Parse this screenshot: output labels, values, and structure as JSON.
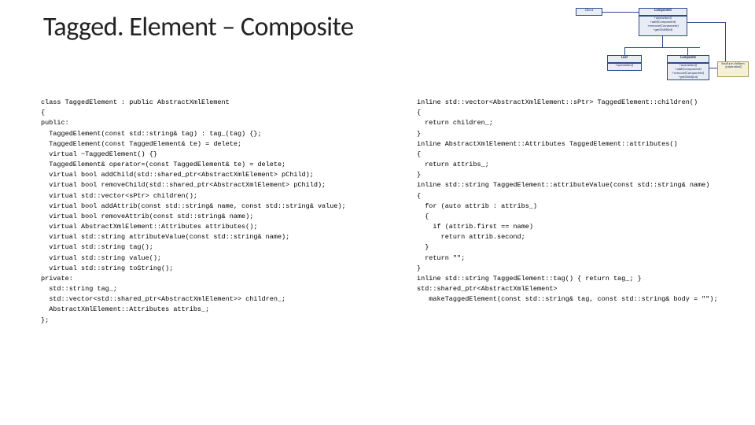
{
  "title": "Tagged. Element – Composite",
  "diagram": {
    "client": "Client",
    "component": "Component",
    "component_body": "+operation()\n+add(Component)\n+remove(Component)\n+getChild(int)",
    "leaf": "Leaf",
    "leaf_body": "+operation()",
    "composite": "Composite",
    "composite_body": "+operation()\n+add(Component)\n+remove(Component)\n+getChild(int)",
    "note": "forall g in children\n  g.operation()"
  },
  "code_left": "class TaggedElement : public AbstractXmlElement\n{\npublic:\n  TaggedElement(const std::string& tag) : tag_(tag) {};\n  TaggedElement(const TaggedElement& te) = delete;\n  virtual ~TaggedElement() {}\n  TaggedElement& operator=(const TaggedElement& te) = delete;\n  virtual bool addChild(std::shared_ptr<AbstractXmlElement> pChild);\n  virtual bool removeChild(std::shared_ptr<AbstractXmlElement> pChild);\n  virtual std::vector<sPtr> children();\n  virtual bool addAttrib(const std::string& name, const std::string& value);\n  virtual bool removeAttrib(const std::string& name);\n  virtual AbstractXmlElement::Attributes attributes();\n  virtual std::string attributeValue(const std::string& name);\n  virtual std::string tag();\n  virtual std::string value();\n  virtual std::string toString();\nprivate:\n  std::string tag_;\n  std::vector<std::shared_ptr<AbstractXmlElement>> children_;\n  AbstractXmlElement::Attributes attribs_;\n};",
  "code_right": "inline std::vector<AbstractXmlElement::sPtr> TaggedElement::children()\n{\n  return children_;\n}\ninline AbstractXmlElement::Attributes TaggedElement::attributes()\n{\n  return attribs_;\n}\ninline std::string TaggedElement::attributeValue(const std::string& name)\n{\n  for (auto attrib : attribs_)\n  {\n    if (attrib.first == name)\n      return attrib.second;\n  }\n  return \"\";\n}\ninline std::string TaggedElement::tag() { return tag_; }\nstd::shared_ptr<AbstractXmlElement>\n   makeTaggedElement(const std::string& tag, const std::string& body = \"\");"
}
